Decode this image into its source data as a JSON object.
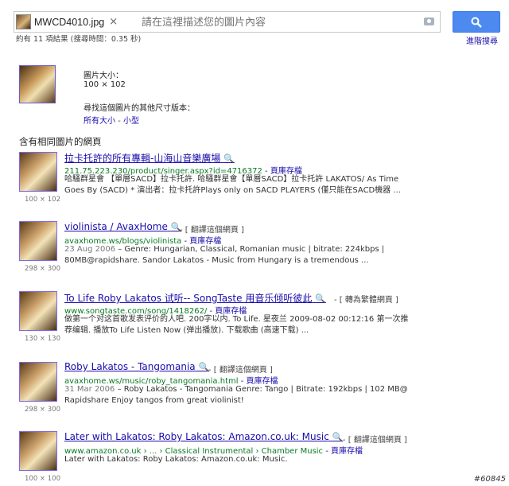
{
  "search": {
    "file_name": "MWCD4010.jpg",
    "clear_glyph": "×",
    "placeholder": "請在這裡描述您的圖片內容",
    "advanced_label": "進階搜尋",
    "stats": "約有 11 項結果 (搜尋時間：0.35 秒)"
  },
  "image_info": {
    "size_label": "圖片大小：",
    "size_value": "100 × 102",
    "other_sizes_label": "尋找這個圖片的其他尺寸版本：",
    "all_sizes": "所有大小",
    "sep": " - ",
    "small": "小型"
  },
  "section_title": "含有相同圖片的網頁",
  "results": [
    {
      "title": "拉卡托許的所有專輯-山海山音樂廣場",
      "aux": "",
      "url": "211.75.223.230/product/singer.aspx?id=4716372",
      "cache": " - 頁庫存檔",
      "date": "",
      "snippet1": "哈騷群星會 【單層SACD】拉卡托許. 哈騷群星會【單層SACD】拉卡托許 LAKATOS/ As Time",
      "snippet2": "Goes By (SACD) * 演出者：拉卡托許Plays only on SACD PLAYERS (僅只能在SACD機器 ...",
      "dim": "100 × 102"
    },
    {
      "title": "violinista / AvaxHome",
      "aux": " - [ 翻譯這個網頁 ]",
      "url": "avaxhome.ws/blogs/violinista",
      "cache": " - 頁庫存檔",
      "date": "23 Aug 2006",
      "snippet1": " – Genre: Hungarian, Classical, Romanian music | bitrate: 224kbps |",
      "snippet2": "80MB@rapidshare. Sandor Lakatos - Music from Hungary is a tremendous ...",
      "dim": "298 × 300"
    },
    {
      "title": "To Life Roby Lakatos 试听-- SongTaste 用音乐倾听彼此",
      "aux": " - [ 轉為繁體網頁 ]",
      "url": "www.songtaste.com/song/1418262/",
      "cache": " - 頁庫存檔",
      "date": "",
      "snippet1": "做第一个对这首歌发表评价的人吧. 200字以内. To Life. 星夜兰 2009-08-02 00:12:16 第一次推",
      "snippet2": "荐编辑. 播放To Life Listen Now (弹出播放). 下载歌曲 (高速下载) ...",
      "dim": "130 × 130"
    },
    {
      "title": "Roby Lakatos - Tangomania",
      "aux": " - [ 翻譯這個網頁 ]",
      "url": "avaxhome.ws/music/roby_tangomania.html",
      "cache": " - 頁庫存檔",
      "date": "31 Mar 2006",
      "snippet1": " – Roby Lakatos - Tangomania Genre: Tango | Bitrate: 192kbps | 102 MB@",
      "snippet2": "Rapidshare Enjoy tangos from great violinist!",
      "dim": "298 × 300"
    },
    {
      "title": "Later with Lakatos: Roby Lakatos: Amazon.co.uk: Music",
      "aux": " - [ 翻譯這個網頁 ]",
      "url": "www.amazon.co.uk › ... › Classical Instrumental › Chamber Music",
      "cache": " - 頁庫存檔",
      "date": "",
      "snippet1": "Later with Lakatos: Roby Lakatos: Amazon.co.uk: Music.",
      "snippet2": "",
      "dim": "100 × 100"
    }
  ],
  "watermark": "#60845",
  "colors": {
    "link": "#1a0dab",
    "url": "#0a7a22",
    "button": "#4c8af0"
  }
}
